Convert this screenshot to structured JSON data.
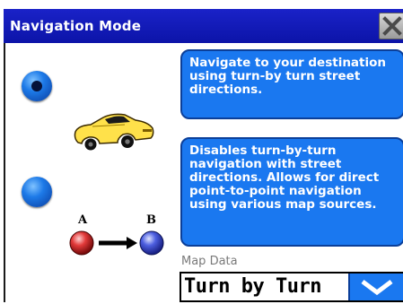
{
  "window": {
    "title": "Navigation Mode"
  },
  "options": [
    {
      "id": "turn-by-turn",
      "selected": true,
      "description": "Navigate to your destination using turn-by turn street directions."
    },
    {
      "id": "point-to-point",
      "selected": false,
      "description": "Disables turn-by-turn navigation with street directions. Allows for direct point-to-point navigation using various map sources.",
      "point_a_label": "A",
      "point_b_label": "B"
    }
  ],
  "map_data": {
    "label": "Map Data",
    "value": "Turn by Turn"
  },
  "colors": {
    "title_bar": "#0c14a8",
    "description_box": "#1a78f0",
    "point_a": "#e23a3a",
    "point_b": "#4d5fe0",
    "car": "#ffe14a"
  }
}
